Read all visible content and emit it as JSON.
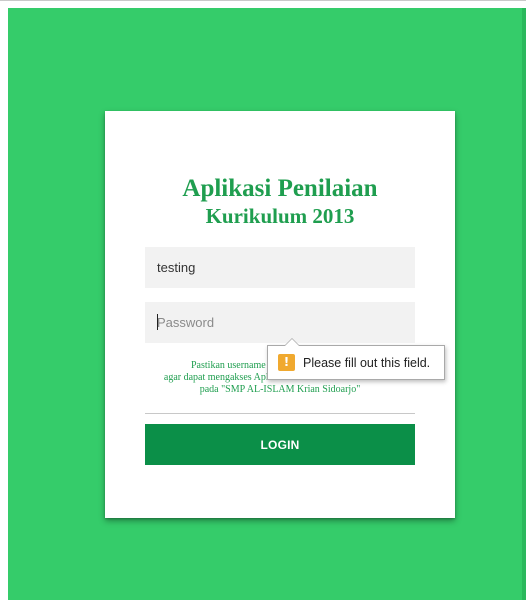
{
  "app": {
    "title": "Aplikasi Penilaian",
    "subtitle": "Kurikulum 2013"
  },
  "form": {
    "username_value": "testing",
    "password_placeholder": "Password",
    "info_line1": "Pastikan username dan password anda benar",
    "info_line2": "agar dapat mengakses Aplikasi Penilaian Kurikulum 2013",
    "info_line3": "pada \"SMP AL-ISLAM Krian Sidoarjo\"",
    "login_label": "LOGIN"
  },
  "validation": {
    "message": "Please fill out this field.",
    "icon": "warning-icon",
    "icon_glyph": "!"
  },
  "colors": {
    "background": "#35cc6a",
    "title": "#1f9e4f",
    "button": "#0b8f48",
    "warning": "#f0a92f"
  }
}
